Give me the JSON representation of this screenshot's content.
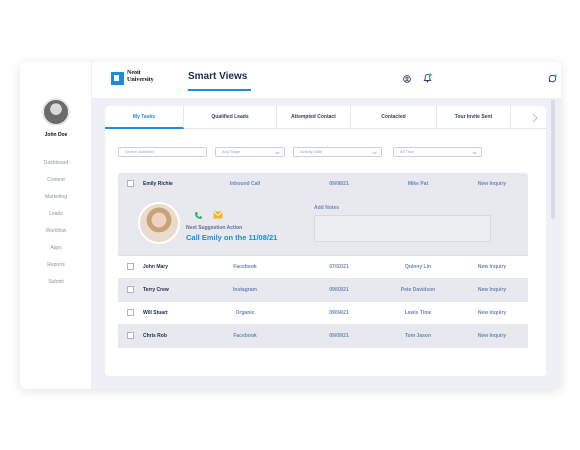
{
  "app": {
    "logo_line1": "Neoit",
    "logo_line2": "University",
    "title": "Smart Views"
  },
  "user": {
    "name": "John Doe"
  },
  "sidebar": {
    "items": [
      {
        "label": "Dashboard"
      },
      {
        "label": "Content"
      },
      {
        "label": "Marketing"
      },
      {
        "label": "Leads"
      },
      {
        "label": "Workflow"
      },
      {
        "label": "Apps"
      },
      {
        "label": "Reports"
      },
      {
        "label": "Submit"
      }
    ]
  },
  "tabs": [
    {
      "label": "My Tasks",
      "active": true
    },
    {
      "label": "Qualified Leads",
      "active": false
    },
    {
      "label": "Attempted Contact",
      "active": false
    },
    {
      "label": "Contacted",
      "active": false
    },
    {
      "label": "Tour Invite Sent",
      "active": false
    }
  ],
  "filters": {
    "search_placeholder": "Search Activities",
    "stage": "Any Stage",
    "date": "Activity Date",
    "time": "All Time"
  },
  "rows": [
    {
      "name": "Emily Richie",
      "source": "Inbound Call",
      "date": "09/08/21",
      "agent": "Mike Pat",
      "status": "New Inquiry"
    },
    {
      "name": "John Mary",
      "source": "Facebook",
      "date": "07/02/21",
      "agent": "Quinny Lin",
      "status": "New Inquiry"
    },
    {
      "name": "Terry Crew",
      "source": "Instagram",
      "date": "09/03/21",
      "agent": "Pete Davidson",
      "status": "New Inquiry"
    },
    {
      "name": "Will Stuart",
      "source": "Organic",
      "date": "09/04/21",
      "agent": "Lewis Time",
      "status": "New Inquiry"
    },
    {
      "name": "Chris Rob",
      "source": "Facebook",
      "date": "09/09/21",
      "agent": "Tom Jason",
      "status": "New Inquiry"
    }
  ],
  "expanded": {
    "next_label": "Next Suggestion Action",
    "next_action": "Call Emily on the 11/08/21",
    "notes_label": "Add Notes"
  },
  "colors": {
    "accent": "#1b8de0",
    "text": "#1b2a4e",
    "muted": "#6e86b8",
    "phone": "#35b26b",
    "mail": "#f0b62a"
  }
}
